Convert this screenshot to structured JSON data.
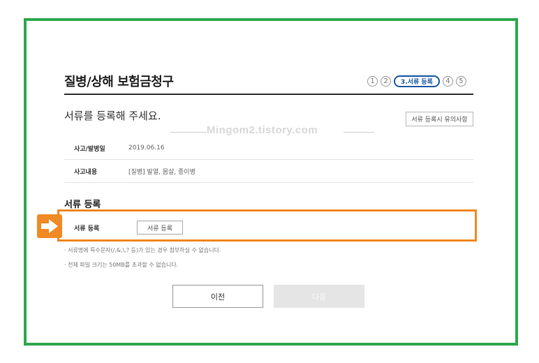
{
  "page": {
    "title": "질병/상해 보험금청구",
    "subtitle": "서류를 등록해 주세요.",
    "watermark": "Mingom2.tistory.com"
  },
  "steps": {
    "items": [
      "1",
      "2",
      "3.서류 등록",
      "4",
      "5"
    ],
    "active_index": 2
  },
  "notice_button": "서류 등록시 유의사항",
  "info_table": {
    "rows": [
      {
        "label": "사고/발병일",
        "value": "2019.06.16"
      },
      {
        "label": "사고내용",
        "value": "[질병] 발열, 몸살, 종이병"
      }
    ]
  },
  "upload_section": {
    "title": "서류 등록",
    "row_label": "서류 등록",
    "button_label": "서류 등록"
  },
  "notes": [
    "· 서류명에 특수문자(/,&,\\,? 등)가 있는 경우 첨부하실 수 없습니다.",
    "· 전체 파일 크기는 50MB를 초과할 수 없습니다."
  ],
  "buttons": {
    "prev": "이전",
    "next": "다음"
  },
  "colors": {
    "frame": "#2fa84f",
    "highlight": "#f08a24",
    "step_active": "#1a5aa6"
  }
}
